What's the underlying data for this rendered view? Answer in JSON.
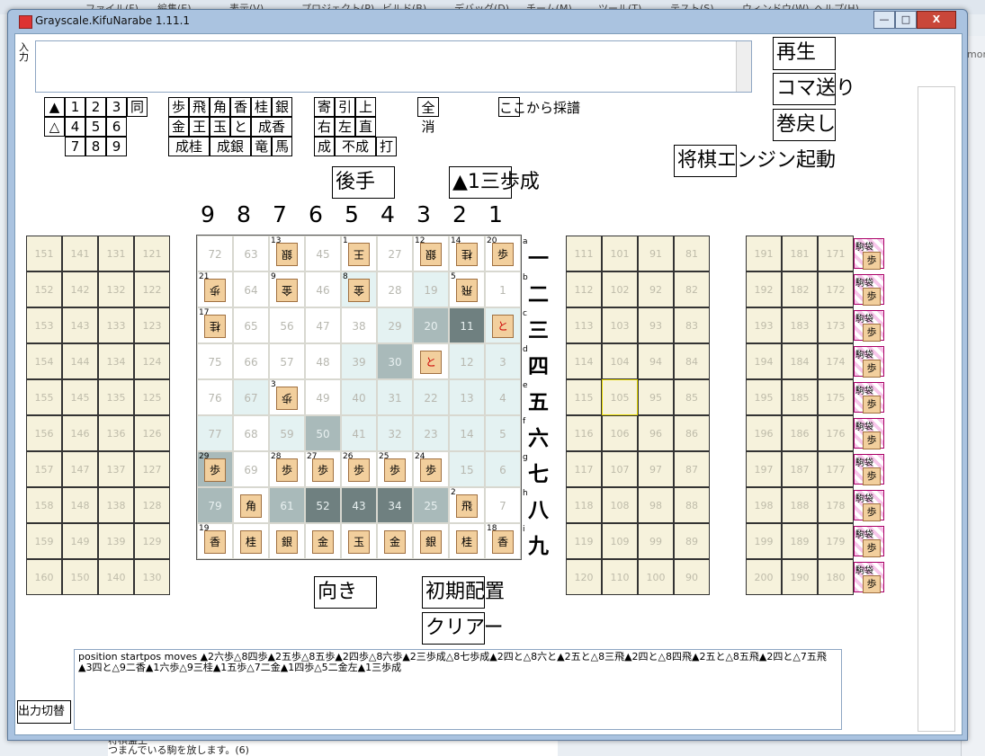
{
  "ide": {
    "menu": [
      "ファイル(F)",
      "編集(E)",
      "表示(V)",
      "プロジェクト(P)",
      "ビルド(B)",
      "デバッグ(D)",
      "チーム(M)",
      "ツール(T)",
      "テスト(S)",
      "ウィンドウ(W)",
      "ヘルプ(H)"
    ],
    "right_tab_text": "mor",
    "bottom_line1": "将棋盤上",
    "bottom_line2": "つまんでいる駒を放します。(6)"
  },
  "window": {
    "title": "Grayscale.KifuNarabe 1.11.1",
    "min_label": "—",
    "max_label": "□",
    "close_label": "X"
  },
  "input": {
    "label": "入力",
    "value": ""
  },
  "keypad": {
    "row1": [
      "▲",
      "1",
      "2",
      "3",
      "同"
    ],
    "row2": [
      "△",
      "4",
      "5",
      "6"
    ],
    "row3": [
      "7",
      "8",
      "9"
    ]
  },
  "piece_keys": {
    "row1": [
      "歩",
      "飛",
      "角",
      "香",
      "桂",
      "銀"
    ],
    "row2": [
      "金",
      "王",
      "玉",
      "と",
      "成香"
    ],
    "row3": [
      "成桂",
      "成銀",
      "竜",
      "馬"
    ]
  },
  "modifier_keys": {
    "row1": [
      "寄",
      "引",
      "上"
    ],
    "row2": [
      "右",
      "左",
      "直"
    ],
    "row3": [
      "成",
      "不成",
      "打"
    ]
  },
  "zenshou": "全消",
  "koko_kara": "ここから採譜",
  "right_buttons": {
    "play": "再生",
    "step": "コマ送り",
    "rewind": "巻戻し",
    "engine": "将棋エンジン起動"
  },
  "turn_label": "後手",
  "last_move": "▲1三歩成",
  "file_labels": [
    "9",
    "8",
    "7",
    "6",
    "5",
    "4",
    "3",
    "2",
    "1"
  ],
  "rank_labels": [
    "一",
    "二",
    "三",
    "四",
    "五",
    "六",
    "七",
    "八",
    "九"
  ],
  "rank_letters": [
    "a",
    "b",
    "c",
    "d",
    "e",
    "f",
    "g",
    "h",
    "i"
  ],
  "board_numbers": [
    [
      "72",
      "63",
      "54",
      "45",
      "36",
      "27",
      "18",
      "9",
      "20"
    ],
    [
      "21",
      "64",
      "55",
      "46",
      "37",
      "28",
      "19",
      "10",
      "1"
    ],
    [
      "74",
      "65",
      "56",
      "47",
      "38",
      "29",
      "20",
      "11",
      "2"
    ],
    [
      "75",
      "66",
      "57",
      "48",
      "39",
      "30",
      "21",
      "12",
      "3"
    ],
    [
      "76",
      "67",
      "58",
      "49",
      "40",
      "31",
      "22",
      "13",
      "4"
    ],
    [
      "77",
      "68",
      "59",
      "50",
      "41",
      "32",
      "23",
      "14",
      "5"
    ],
    [
      "78",
      "69",
      "60",
      "51",
      "42",
      "33",
      "24",
      "15",
      "6"
    ],
    [
      "79",
      "70",
      "61",
      "52",
      "43",
      "34",
      "25",
      "16",
      "7"
    ],
    [
      "80",
      "71",
      "62",
      "53",
      "44",
      "35",
      "26",
      "17",
      "8"
    ]
  ],
  "left_stand": [
    [
      "151",
      "141",
      "131",
      "121"
    ],
    [
      "152",
      "142",
      "132",
      "122"
    ],
    [
      "153",
      "143",
      "133",
      "123"
    ],
    [
      "154",
      "144",
      "134",
      "124"
    ],
    [
      "155",
      "145",
      "135",
      "125"
    ],
    [
      "156",
      "146",
      "136",
      "126"
    ],
    [
      "157",
      "147",
      "137",
      "127"
    ],
    [
      "158",
      "148",
      "138",
      "128"
    ],
    [
      "159",
      "149",
      "139",
      "129"
    ],
    [
      "160",
      "150",
      "140",
      "130"
    ]
  ],
  "right_stand": [
    [
      "111",
      "101",
      "91",
      "81"
    ],
    [
      "112",
      "102",
      "92",
      "82"
    ],
    [
      "113",
      "103",
      "93",
      "83"
    ],
    [
      "114",
      "104",
      "94",
      "84"
    ],
    [
      "115",
      "105",
      "95",
      "85"
    ],
    [
      "116",
      "106",
      "96",
      "86"
    ],
    [
      "117",
      "107",
      "97",
      "87"
    ],
    [
      "118",
      "108",
      "98",
      "88"
    ],
    [
      "119",
      "109",
      "99",
      "89"
    ],
    [
      "120",
      "110",
      "100",
      "90"
    ]
  ],
  "far_right": [
    [
      "191",
      "181",
      "171"
    ],
    [
      "192",
      "182",
      "172"
    ],
    [
      "193",
      "183",
      "173"
    ],
    [
      "194",
      "184",
      "174"
    ],
    [
      "195",
      "185",
      "175"
    ],
    [
      "196",
      "186",
      "176"
    ],
    [
      "197",
      "187",
      "177"
    ],
    [
      "198",
      "188",
      "178"
    ],
    [
      "199",
      "189",
      "179"
    ],
    [
      "200",
      "190",
      "180"
    ]
  ],
  "komabukuro_label": "駒袋",
  "komabukuro_piece": "歩",
  "pieces": [
    {
      "r": 0,
      "c": 2,
      "n": "13",
      "t": "銀",
      "gote": true
    },
    {
      "r": 0,
      "c": 4,
      "n": "1",
      "t": "王",
      "gote": true
    },
    {
      "r": 0,
      "c": 6,
      "n": "12",
      "t": "銀",
      "gote": true
    },
    {
      "r": 0,
      "c": 7,
      "n": "14",
      "t": "桂",
      "gote": true
    },
    {
      "r": 0,
      "c": 8,
      "n": "20",
      "t": "歩",
      "gote": false
    },
    {
      "r": 1,
      "c": 0,
      "n": "21",
      "t": "歩",
      "gote": true
    },
    {
      "r": 1,
      "c": 2,
      "n": "9",
      "t": "金",
      "gote": true
    },
    {
      "r": 1,
      "c": 4,
      "n": "8",
      "t": "金",
      "gote": true
    },
    {
      "r": 1,
      "c": 7,
      "n": "5",
      "t": "飛",
      "gote": true
    },
    {
      "r": 2,
      "c": 0,
      "n": "17",
      "t": "桂",
      "gote": true
    },
    {
      "r": 2,
      "c": 8,
      "n": "",
      "t": "と",
      "gote": false,
      "red": true
    },
    {
      "r": 3,
      "c": 6,
      "n": "",
      "t": "と",
      "gote": false,
      "red": true
    },
    {
      "r": 4,
      "c": 2,
      "n": "3",
      "t": "歩",
      "gote": true
    },
    {
      "r": 6,
      "c": 0,
      "n": "29",
      "t": "歩",
      "gote": false
    },
    {
      "r": 6,
      "c": 2,
      "n": "28",
      "t": "歩",
      "gote": false
    },
    {
      "r": 6,
      "c": 3,
      "n": "27",
      "t": "歩",
      "gote": false
    },
    {
      "r": 6,
      "c": 4,
      "n": "26",
      "t": "歩",
      "gote": false
    },
    {
      "r": 6,
      "c": 5,
      "n": "25",
      "t": "歩",
      "gote": false
    },
    {
      "r": 6,
      "c": 6,
      "n": "24",
      "t": "歩",
      "gote": false
    },
    {
      "r": 7,
      "c": 1,
      "n": "",
      "t": "角",
      "gote": false
    },
    {
      "r": 7,
      "c": 7,
      "n": "2",
      "t": "飛",
      "gote": false
    },
    {
      "r": 8,
      "c": 0,
      "n": "19",
      "t": "香",
      "gote": false
    },
    {
      "r": 8,
      "c": 1,
      "n": "",
      "t": "桂",
      "gote": false
    },
    {
      "r": 8,
      "c": 2,
      "n": "",
      "t": "銀",
      "gote": false
    },
    {
      "r": 8,
      "c": 3,
      "n": "",
      "t": "金",
      "gote": false
    },
    {
      "r": 8,
      "c": 4,
      "n": "",
      "t": "玉",
      "gote": false
    },
    {
      "r": 8,
      "c": 5,
      "n": "",
      "t": "金",
      "gote": false
    },
    {
      "r": 8,
      "c": 6,
      "n": "",
      "t": "銀",
      "gote": false
    },
    {
      "r": 8,
      "c": 7,
      "n": "",
      "t": "桂",
      "gote": false
    },
    {
      "r": 8,
      "c": 8,
      "n": "18",
      "t": "香",
      "gote": false
    }
  ],
  "highlight_cells": {
    "light": [
      [
        1,
        4
      ],
      [
        1,
        6
      ],
      [
        2,
        5
      ],
      [
        3,
        4
      ],
      [
        4,
        1
      ],
      [
        4,
        4
      ],
      [
        4,
        5
      ],
      [
        4,
        6
      ],
      [
        4,
        7
      ],
      [
        4,
        8
      ],
      [
        5,
        0
      ],
      [
        5,
        2
      ],
      [
        5,
        4
      ],
      [
        5,
        5
      ],
      [
        5,
        6
      ],
      [
        5,
        7
      ],
      [
        5,
        8
      ],
      [
        6,
        7
      ],
      [
        6,
        8
      ],
      [
        3,
        8
      ],
      [
        3,
        7
      ],
      [
        2,
        8
      ]
    ],
    "mid": [
      [
        2,
        6
      ],
      [
        2,
        7
      ],
      [
        3,
        5
      ],
      [
        5,
        3
      ],
      [
        6,
        0
      ],
      [
        7,
        0
      ],
      [
        7,
        6
      ],
      [
        7,
        2
      ]
    ],
    "dark": [
      [
        2,
        7
      ],
      [
        7,
        3
      ],
      [
        7,
        4
      ],
      [
        7,
        5
      ]
    ]
  },
  "buttons_bottom": {
    "orientation": "向き",
    "initial": "初期配置",
    "clear": "クリアー",
    "output_toggle": "出力切替"
  },
  "kifu_text": "position startpos moves ▲2六歩△8四歩▲2五歩△8五歩▲2四歩△8六歩▲2三歩成△8七歩成▲2四と△8六と▲2五と△8三飛▲2四と△8四飛▲2五と△8五飛▲2四と△7五飛▲3四と△9二香▲1六歩△9三桂▲1五歩△7二金▲1四歩△5二金左▲1三歩成"
}
